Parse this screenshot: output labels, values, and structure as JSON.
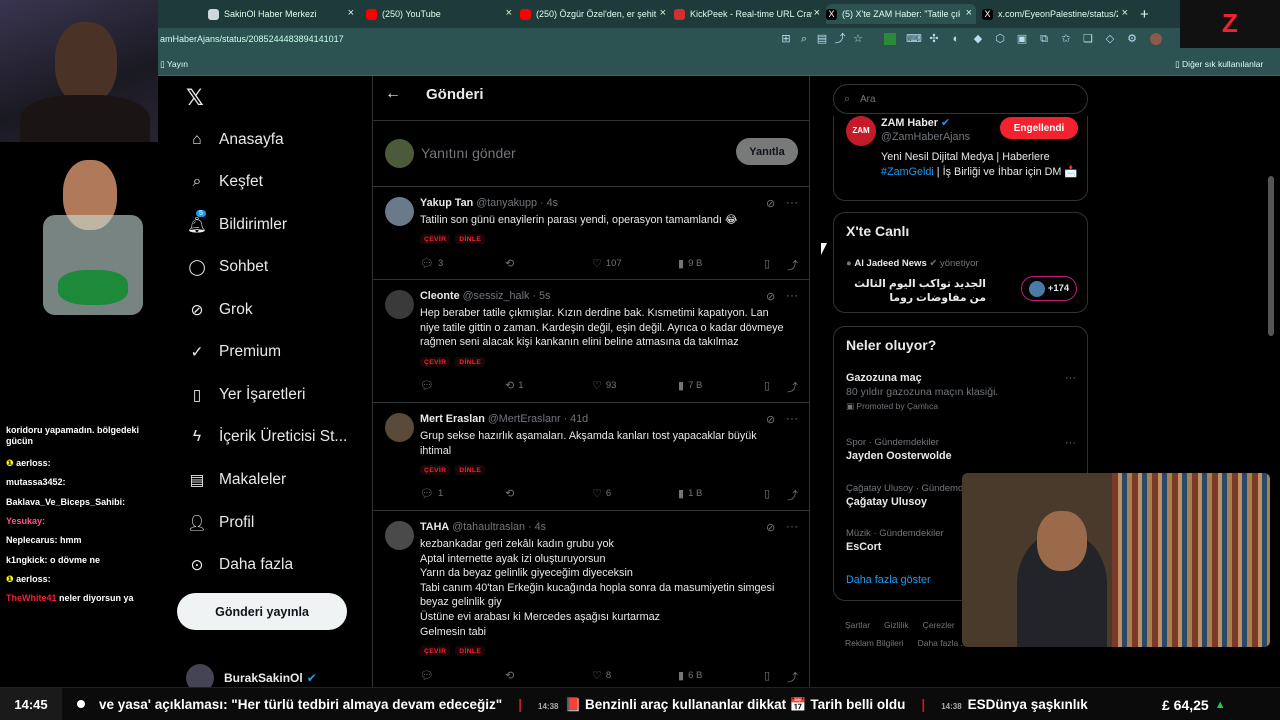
{
  "browser": {
    "tabs": [
      {
        "label": "SakinOl Haber Merkezi",
        "color": "#cfd8dc"
      },
      {
        "label": "(250) YouTube",
        "color": "#ff0000"
      },
      {
        "label": "(250) Özgür Özel'den, er şehit ya",
        "color": "#ff0000"
      },
      {
        "label": "KickPeek - Real-time URL Crawle",
        "color": "#d32f2f"
      },
      {
        "label": "(5) X'te ZAM Haber: \"Tatile çıkan",
        "color": "#000000"
      },
      {
        "label": "x.com/EyeonPalestine/status/20",
        "color": "#000000"
      }
    ],
    "url": "amHaberAjans/status/2085244483894141017",
    "bookmarks": {
      "left": "Yayın",
      "right": "Diğer sık kullanılanlar"
    }
  },
  "overlay": {
    "logo": "Z"
  },
  "chat": [
    {
      "user": "koridoru yapamadın. bölgedeki gücün",
      "msg": ""
    },
    {
      "user": "aerloss:",
      "msg": ""
    },
    {
      "user": "mutassa3452:",
      "msg": ""
    },
    {
      "user": "Baklava_Ve_Biceps_Sahibi:",
      "msg": ""
    },
    {
      "user": "Yesukay:",
      "msg": ""
    },
    {
      "user": "Neplecarus:",
      "msg": "hmm"
    },
    {
      "user": "k1ngkick:",
      "msg": "o dövme ne"
    },
    {
      "user": "aerloss:",
      "msg": ""
    },
    {
      "user": "TheWhite41",
      "msg": "neler diyorsun ya"
    }
  ],
  "nav": {
    "items": [
      {
        "label": "Anasayfa",
        "icon": "home-icon"
      },
      {
        "label": "Keşfet",
        "icon": "search-icon"
      },
      {
        "label": "Bildirimler",
        "icon": "bell-icon",
        "badge": "5"
      },
      {
        "label": "Sohbet",
        "icon": "chat-icon"
      },
      {
        "label": "Grok",
        "icon": "grok-icon"
      },
      {
        "label": "Premium",
        "icon": "premium-icon"
      },
      {
        "label": "Yer İşaretleri",
        "icon": "bookmark-icon"
      },
      {
        "label": "İçerik Üreticisi St...",
        "icon": "lightning-icon"
      },
      {
        "label": "Makaleler",
        "icon": "article-icon"
      },
      {
        "label": "Profil",
        "icon": "profile-icon"
      },
      {
        "label": "Daha fazla",
        "icon": "more-icon"
      }
    ],
    "post_button": "Gönderi yayınla",
    "account": "BurakSakinOl"
  },
  "main": {
    "title": "Gönderi",
    "reply_placeholder": "Yanıtını gönder",
    "reply_button": "Yanıtla",
    "tweets": [
      {
        "name": "Yakup Tan",
        "handle": "@tanyakupp",
        "time": "· 4s",
        "lines": [
          "Tatilin son günü enayilerin parası yendi, operasyon tamamlandı 😂"
        ],
        "tags": [
          "ÇEVİR",
          "DİNLE"
        ],
        "replies": "3",
        "retweets": "",
        "likes": "107",
        "views": "9 B"
      },
      {
        "name": "Cleonte",
        "handle": "@sessiz_halk",
        "time": "· 5s",
        "lines": [
          "Hep beraber tatile çıkmışlar. Kızın derdine bak. Kısmetimi kapatıyon. Lan",
          "niye tatile gittin o zaman. Kardeşin değil, eşin değil. Ayrıca o kadar dövmeye",
          "rağmen seni alacak kişi kankanın elini beline atmasına da takılmaz"
        ],
        "tags": [
          "ÇEVİR",
          "DİNLE"
        ],
        "replies": "",
        "retweets": "1",
        "likes": "93",
        "views": "7 B"
      },
      {
        "name": "Mert Eraslan",
        "handle": "@MertEraslanr",
        "time": "· 41d",
        "lines": [
          "Grup sekse hazırlık aşamaları. Akşamda kanları tost yapacaklar büyük",
          "ihtimal"
        ],
        "tags": [
          "ÇEVİR",
          "DİNLE"
        ],
        "replies": "1",
        "retweets": "",
        "likes": "6",
        "views": "1 B"
      },
      {
        "name": "TAHA",
        "handle": "@tahaultraslan",
        "time": "· 4s",
        "lines": [
          "kezbankadar geri zekâlı kadın grubu yok",
          "Aptal internette ayak izi oluşturuyorsun",
          "Yarın da beyaz gelinlik giyeceğim  diyeceksin",
          "Tabi canım 40'tan Erkeğin  kucağında hopla sonra da masumiyetin simgesi",
          "beyaz gelinlik giy",
          "Üstüne evi arabası ki Mercedes aşağısı kurtarmaz",
          "Gelmesin tabi"
        ],
        "tags": [
          "ÇEVİR",
          "DİNLE"
        ],
        "replies": "",
        "retweets": "",
        "likes": "8",
        "views": "6 B"
      }
    ]
  },
  "side": {
    "search_placeholder": "Ara",
    "zam": {
      "logo": "ZAM",
      "name": "ZAM Haber",
      "handle": "@ZamHaberAjans",
      "button": "Engellendi",
      "bio_a": "Yeni Nesil Dijital Medya | Haberlere",
      "bio_tag": "#ZamGeldi",
      "bio_b": " | İş Birliği ve İhbar için DM",
      "bio_c": "📩"
    },
    "live": {
      "title": "X'te Canlı",
      "source": "Al Jadeed News",
      "role": "yönetiyor",
      "headline": "الجديد تواكب اليوم الثالث من مفاوضات روما",
      "count": "+174"
    },
    "trends": {
      "title": "Neler oluyor?",
      "items": [
        {
          "ctx": "",
          "name": "Gazozuna maç",
          "sub": "80 yıldır gazozuna maçın klasiği.",
          "promo": "Promoted by Çamlıca"
        },
        {
          "ctx": "Spor · Gündemdekiler",
          "name": "Jayden Oosterwolde",
          "sub": "",
          "promo": ""
        },
        {
          "ctx": "Çağatay Ulusoy · Gündemde",
          "name": "Çağatay Ulusoy",
          "sub": "",
          "promo": ""
        },
        {
          "ctx": "Müzik · Gündemdekiler",
          "name": "EsCort",
          "sub": "",
          "promo": ""
        }
      ],
      "show_more": "Daha fazla göster"
    },
    "footer": [
      "Şartlar",
      "Gizlilik",
      "Çerezler",
      "Reklam Bilgileri",
      "Daha fazla ..."
    ]
  },
  "ticker": {
    "time": "14:45",
    "news": [
      {
        "time": "",
        "text": "ve yasa' açıklaması: \"Her türlü tedbiri almaya devam edeceğiz\""
      },
      {
        "time": "14:38",
        "text": "📕 Benzinli araç kullananlar dikkat 📅 Tarih belli oldu"
      },
      {
        "time": "14:38",
        "text": "ESDünya şaşkınlık"
      }
    ],
    "price": "£ 64,25",
    "price_arrow": "▲"
  }
}
